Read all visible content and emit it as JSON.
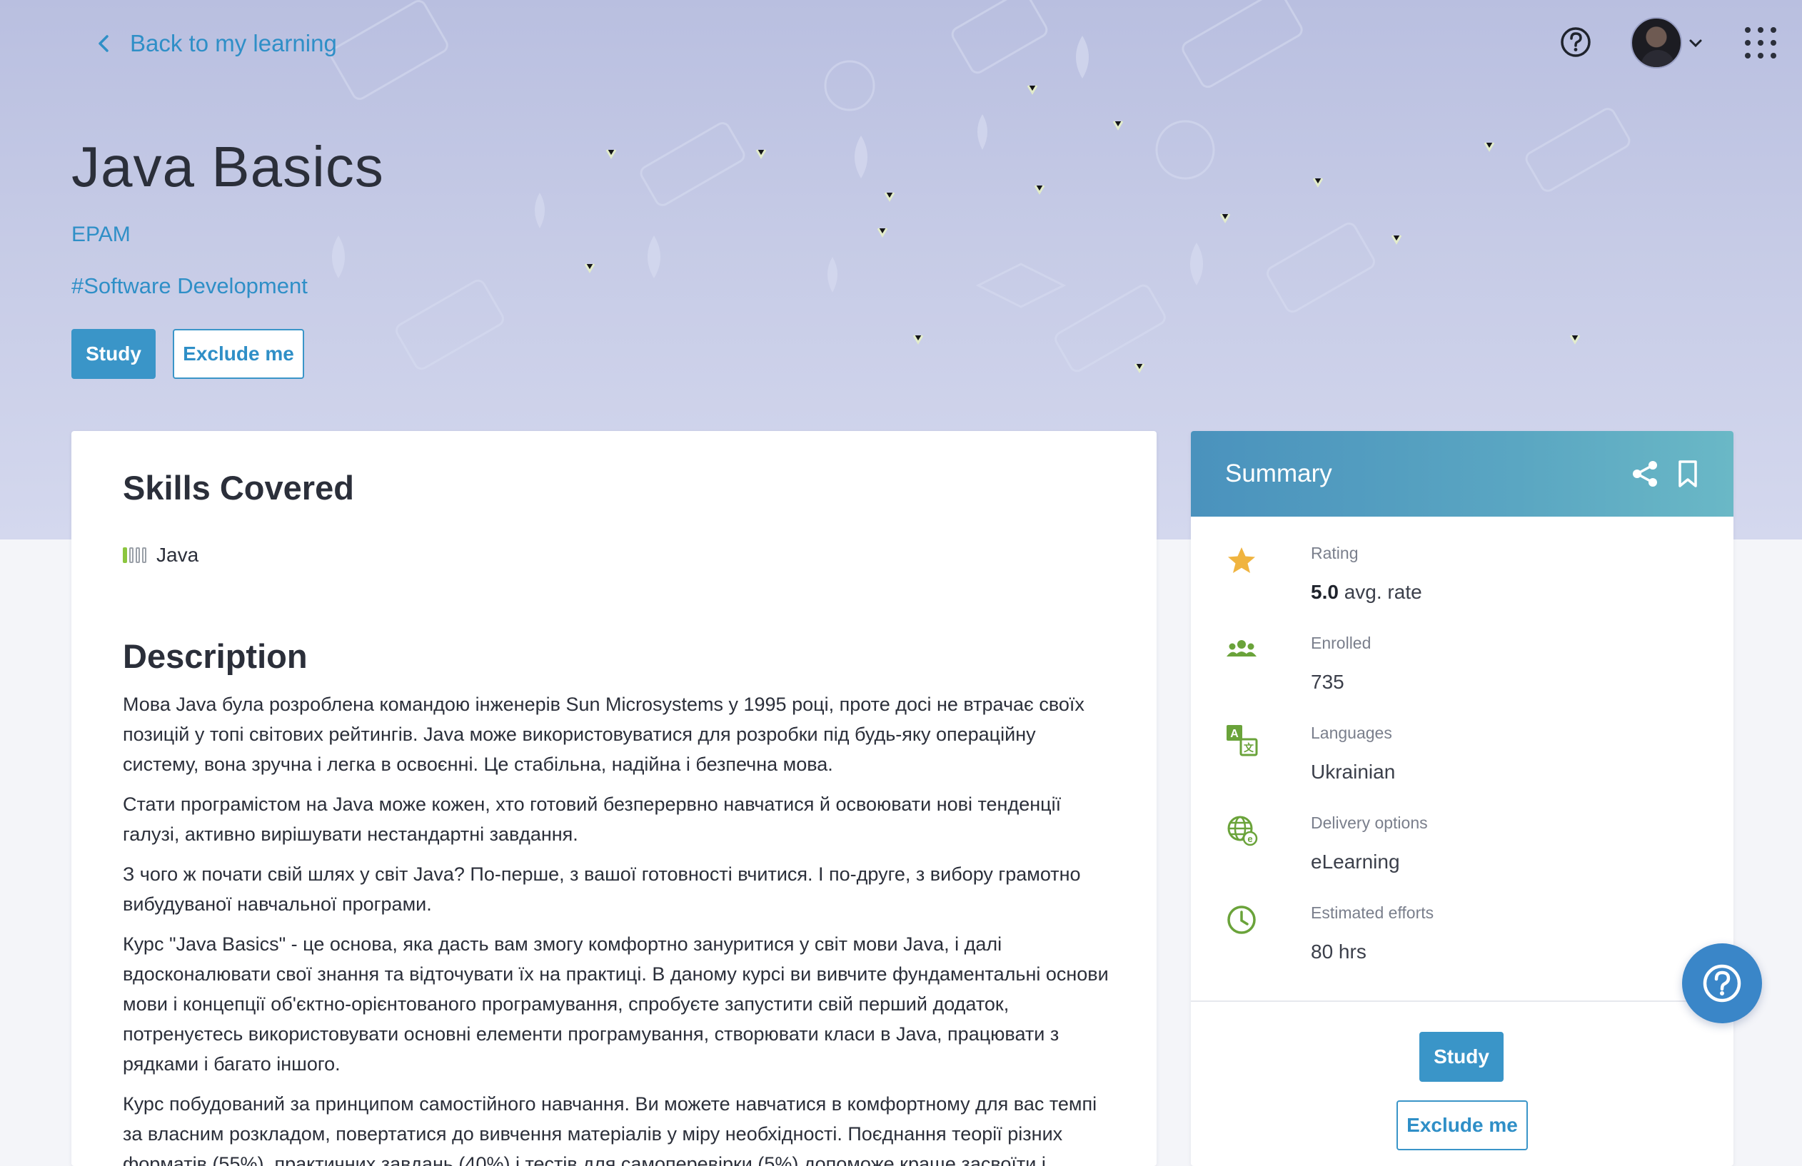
{
  "nav": {
    "back_label": "Back to my learning"
  },
  "course": {
    "title": "Java Basics",
    "provider": "EPAM",
    "tag": "#Software Development",
    "study_label": "Study",
    "exclude_label": "Exclude me"
  },
  "skills": {
    "heading": "Skills Covered",
    "items": [
      {
        "name": "Java",
        "level": 1,
        "max_level": 4
      }
    ]
  },
  "description": {
    "heading": "Description",
    "paragraphs": [
      "Мова Java була розроблена командою інженерів Sun Microsystems у 1995 році, проте досі не втрачає своїх позицій у топі світових рейтингів. Java може використовуватися для розробки під будь-яку операційну систему, вона зручна і легка в освоєнні. Це стабільна, надійна і безпечна мова.",
      "Стати програмістом на Java може кожен, хто готовий безперервно навчатися й освоювати нові тенденції галузі, активно вирішувати нестандартні завдання.",
      "З чого ж почати свій шлях у світ Java? По-перше, з вашої готовності вчитися. І по-друге, з вибору грамотно вибудуваної навчальної програми.",
      "Курс \"Java Basics\" - це основа, яка дасть вам змогу комфортно зануритися у світ мови Java, і далі вдосконалювати свої знання та відточувати їх на практиці. В даному курсі ви вивчите фундаментальні основи мови і концепції об'єктно-орієнтованого програмування, спробуєте запустити свій перший додаток, потренуєтесь використовувати основні елементи програмування, створювати класи в Java, працювати з рядками і багато іншого.",
      "Курс побудований за принципом самостійного навчання. Ви можете навчатися в комфортному для вас темпі за власним розкладом, повертатися до вивчення матеріалів у міру необхідності. Поєднання теорії різних форматів (55%), практичних завдань (40%) і тестів для самоперевірки (5%) допоможе краще засвоїти і"
    ]
  },
  "summary": {
    "title": "Summary",
    "rating_label": "Rating",
    "rating_value": "5.0",
    "rating_suffix": "avg. rate",
    "enrolled_label": "Enrolled",
    "enrolled_value": "735",
    "languages_label": "Languages",
    "languages_value": "Ukrainian",
    "delivery_label": "Delivery options",
    "delivery_value": "eLearning",
    "efforts_label": "Estimated efforts",
    "efforts_value": "80 hrs",
    "study_label": "Study",
    "exclude_label": "Exclude me"
  },
  "icons": {
    "back": "chevron-left-icon",
    "help": "question-circle-icon",
    "apps": "apps-grid-icon",
    "share": "share-icon",
    "bookmark": "bookmark-icon",
    "rating": "star-icon",
    "enrolled": "people-icon",
    "languages": "translate-icon",
    "delivery": "globe-icon",
    "efforts": "clock-icon"
  },
  "colors": {
    "accent": "#3a95c8",
    "link": "#2f8fc7",
    "hero_bg": "#c6cbe6",
    "summary_header": "#4a92bd",
    "star": "#f0b440",
    "icon_green": "#6aa33a",
    "skill_green": "#8cc63f"
  }
}
